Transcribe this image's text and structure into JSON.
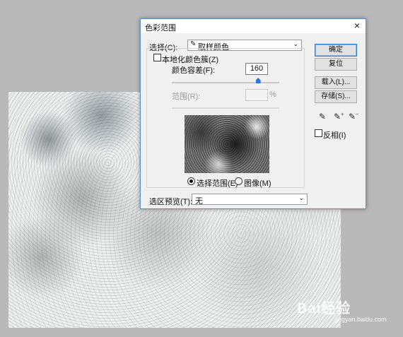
{
  "dialog": {
    "title": "色彩范围",
    "close_glyph": "×",
    "select_label": "选择(C):",
    "select_value": "取样颜色",
    "select_icon": "eyedropper-icon",
    "localized_label": "本地化颜色簇(Z)",
    "fuzziness_label": "颜色容差(F):",
    "fuzziness_value": "160",
    "fuzziness_level": 0.8,
    "range_label": "范围(R):",
    "range_value": "",
    "range_unit": "%",
    "radio_selection": "选择范围(E)",
    "radio_image": "图像(M)",
    "preview_label": "选区预览(T):",
    "preview_value": "无",
    "buttons": {
      "ok": "确定",
      "reset": "复位",
      "load": "载入(L)...",
      "save": "存储(S)..."
    },
    "invert_label": "反相(I)",
    "eyedropper_glyphs": [
      "⁄",
      "⁄⁺",
      "⁄⁻"
    ]
  },
  "watermark": {
    "brand": "Bai经验",
    "url": "jingyan.baidu.com"
  },
  "colors": {
    "accent": "#2b77d6",
    "background": "#b9b9b9",
    "dialog": "#f0f0f0"
  }
}
